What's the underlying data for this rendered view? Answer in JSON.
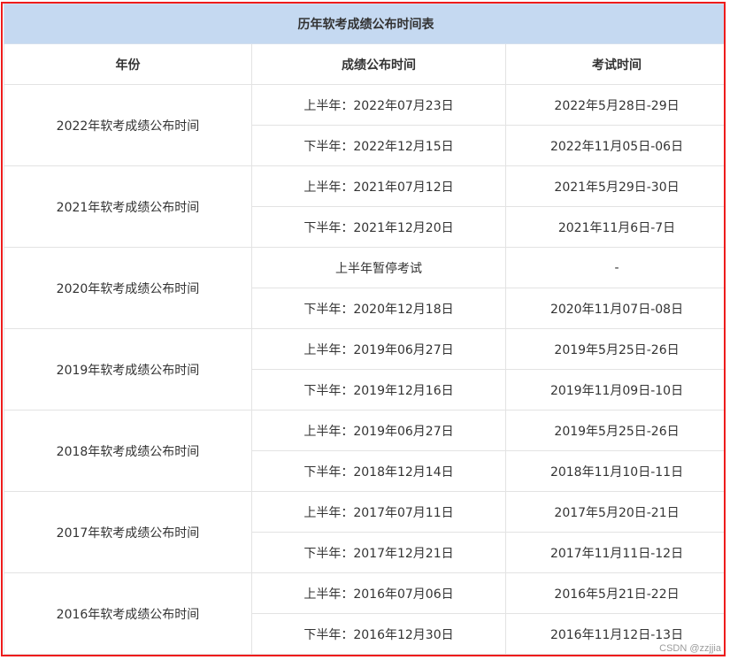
{
  "table": {
    "title": "历年软考成绩公布时间表",
    "headers": [
      "年份",
      "成绩公布时间",
      "考试时间"
    ],
    "rows": [
      {
        "year": "2022年软考成绩公布时间",
        "sub": [
          {
            "publish": "上半年：2022年07月23日",
            "exam": "2022年5月28日-29日"
          },
          {
            "publish": "下半年：2022年12月15日",
            "exam": "2022年11月05日-06日"
          }
        ]
      },
      {
        "year": "2021年软考成绩公布时间",
        "sub": [
          {
            "publish": "上半年：2021年07月12日",
            "exam": "2021年5月29日-30日"
          },
          {
            "publish": "下半年：2021年12月20日",
            "exam": "2021年11月6日-7日"
          }
        ]
      },
      {
        "year": "2020年软考成绩公布时间",
        "sub": [
          {
            "publish": "上半年暂停考试",
            "exam": "-"
          },
          {
            "publish": "下半年：2020年12月18日",
            "exam": "2020年11月07日-08日"
          }
        ]
      },
      {
        "year": "2019年软考成绩公布时间",
        "sub": [
          {
            "publish": "上半年：2019年06月27日",
            "exam": "2019年5月25日-26日"
          },
          {
            "publish": "下半年：2019年12月16日",
            "exam": "2019年11月09日-10日"
          }
        ]
      },
      {
        "year": "2018年软考成绩公布时间",
        "sub": [
          {
            "publish": "上半年：2019年06月27日",
            "exam": "2019年5月25日-26日"
          },
          {
            "publish": "下半年：2018年12月14日",
            "exam": "2018年11月10日-11日"
          }
        ]
      },
      {
        "year": "2017年软考成绩公布时间",
        "sub": [
          {
            "publish": "上半年：2017年07月11日",
            "exam": "2017年5月20日-21日"
          },
          {
            "publish": "下半年：2017年12月21日",
            "exam": "2017年11月11日-12日"
          }
        ]
      },
      {
        "year": "2016年软考成绩公布时间",
        "sub": [
          {
            "publish": "上半年：2016年07月06日",
            "exam": "2016年5月21日-22日"
          },
          {
            "publish": "下半年：2016年12月30日",
            "exam": "2016年11月12日-13日"
          }
        ]
      }
    ]
  },
  "watermark": "CSDN @zzjjia",
  "colors": {
    "title_bg": "#c5d9f1",
    "frame": "#ee1c1c",
    "border": "#e3e3e3"
  }
}
